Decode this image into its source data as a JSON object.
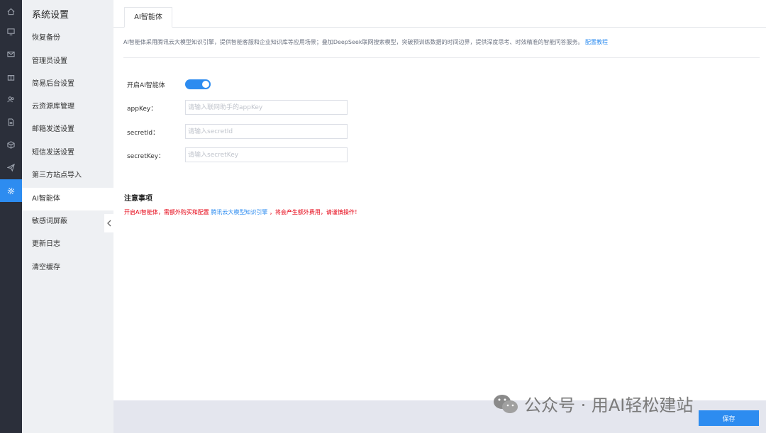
{
  "iconbar": {
    "icons": [
      "home-icon",
      "monitor-icon",
      "mail-icon",
      "gift-icon",
      "users-icon",
      "file-icon",
      "box-icon",
      "send-icon",
      "settings-icon"
    ]
  },
  "sidebar": {
    "title": "系统设置",
    "items": [
      {
        "label": "恢复备份"
      },
      {
        "label": "管理员设置"
      },
      {
        "label": "简易后台设置"
      },
      {
        "label": "云资源库管理"
      },
      {
        "label": "邮箱发送设置"
      },
      {
        "label": "短信发送设置"
      },
      {
        "label": "第三方站点导入"
      },
      {
        "label": "AI智能体",
        "active": true
      },
      {
        "label": "敏感词屏蔽"
      },
      {
        "label": "更新日志"
      },
      {
        "label": "清空缓存"
      }
    ]
  },
  "tabs": [
    {
      "label": "AI智能体"
    }
  ],
  "description": {
    "text": "AI智能体采用腾讯云大模型知识引擎，提供智能客服和企业知识库等应用场景；叠加DeepSeek联网搜索模型，突破预训练数据的时间边界，提供深度思考、时效精准的智能问答服务。",
    "link": "配置教程"
  },
  "form": {
    "enable_label": "开启AI智能体",
    "enabled": true,
    "fields": [
      {
        "label": "appKey：",
        "value": "",
        "placeholder": "请输入联网助手的appKey"
      },
      {
        "label": "secretId：",
        "value": "",
        "placeholder": "请输入secretId"
      },
      {
        "label": "secretKey：",
        "value": "",
        "placeholder": "请输入secretKey"
      }
    ]
  },
  "notice": {
    "title": "注意事项",
    "text_before": "开启AI智能体，需额外购买和配置",
    "link": "腾讯云大模型知识引擎",
    "text_after": "，将会产生额外费用，请谨慎操作！"
  },
  "footer": {
    "save_label": "保存"
  },
  "watermark": {
    "text": "公众号 · 用AI轻松建站"
  },
  "colors": {
    "accent": "#2d8cf0",
    "iconbar": "#2b2f3a",
    "warning": "#e60012"
  }
}
